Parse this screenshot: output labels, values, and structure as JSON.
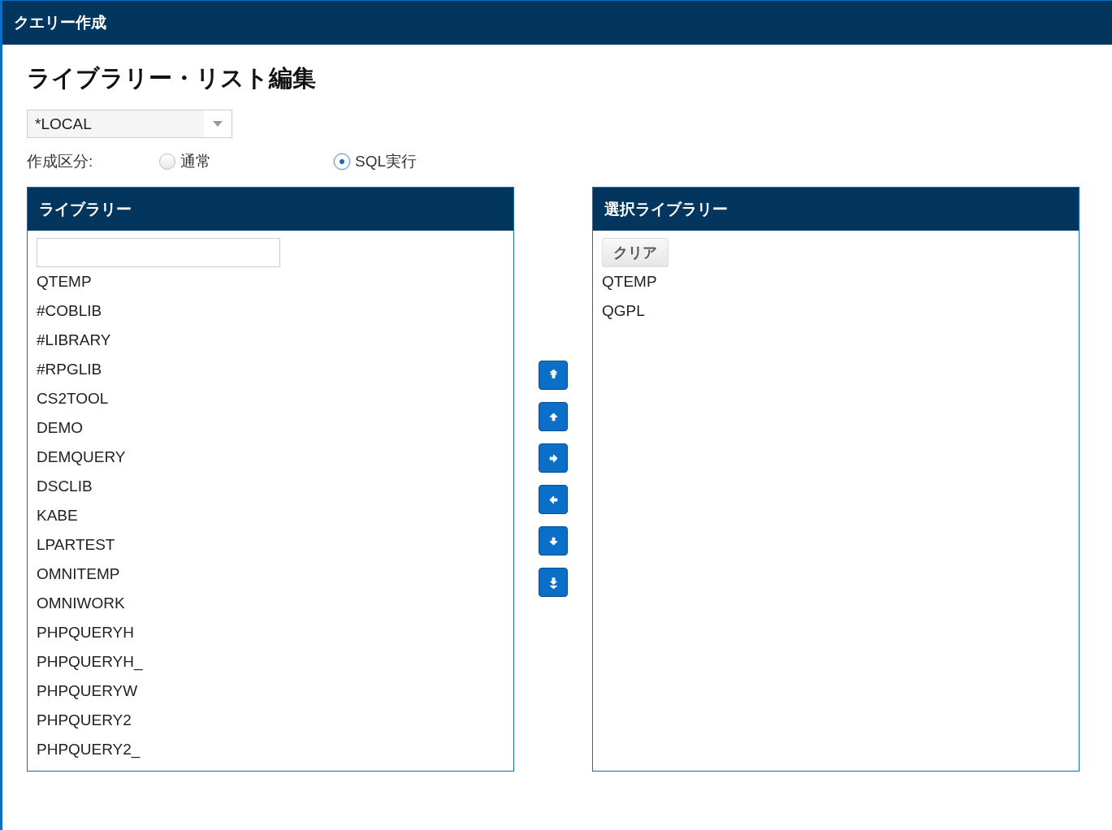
{
  "window": {
    "title": "クエリー作成"
  },
  "page_title": "ライブラリー・リスト編集",
  "system_select": {
    "value": "*LOCAL"
  },
  "creation_type": {
    "label": "作成区分:",
    "options": [
      {
        "label": "通常",
        "selected": false
      },
      {
        "label": "SQL実行",
        "selected": true
      }
    ]
  },
  "library_panel": {
    "title": "ライブラリー",
    "items": [
      "QTEMP",
      "#COBLIB",
      "#LIBRARY",
      "#RPGLIB",
      "CS2TOOL",
      "DEMO",
      "DEMQUERY",
      "DSCLIB",
      "KABE",
      "LPARTEST",
      "OMNITEMP",
      "OMNIWORK",
      "PHPQUERYH",
      "PHPQUERYH_",
      "PHPQUERYW",
      "PHPQUERY2",
      "PHPQUERY2_"
    ]
  },
  "move_buttons": [
    {
      "kind": "top"
    },
    {
      "kind": "up"
    },
    {
      "kind": "right"
    },
    {
      "kind": "left"
    },
    {
      "kind": "down"
    },
    {
      "kind": "bottom"
    }
  ],
  "selected_panel": {
    "title": "選択ライブラリー",
    "clear_button": "クリア",
    "items": [
      "QTEMP",
      "QGPL"
    ]
  }
}
